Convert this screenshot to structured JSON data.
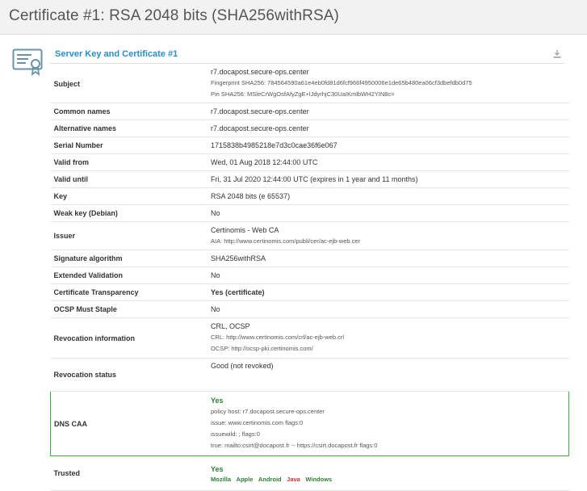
{
  "page": {
    "title": "Certificate #1: RSA 2048 bits (SHA256withRSA)"
  },
  "section": {
    "title": "Server Key and Certificate #1",
    "icon": "certificate-icon",
    "download_icon": "download-icon"
  },
  "colors": {
    "accent": "#2a8ec7",
    "green": "#2e7d32",
    "red": "#d32f2f",
    "dns_border": "#3fae49"
  },
  "rows": {
    "subject": {
      "label": "Subject",
      "value": "r7.docapost.secure-ops.center",
      "fingerprint": "Fingerprint SHA256: 784564590a61e4eb0fd81d6fcf966f4950006e1de65b480ea06cf3dbefdb0d75",
      "pin": "Pin SHA256: MSleCrWgOsfAfyZgE+lJdyrhjC30UaIKmlbWH2YIN8c="
    },
    "common_names": {
      "label": "Common names",
      "value": "r7.docapost.secure-ops.center"
    },
    "alt_names": {
      "label": "Alternative names",
      "value": "r7.docapost.secure-ops.center"
    },
    "serial": {
      "label": "Serial Number",
      "value": "1715838b4985218e7d3c0cae36f6e067"
    },
    "valid_from": {
      "label": "Valid from",
      "value": "Wed, 01 Aug 2018 12:44:00 UTC"
    },
    "valid_until": {
      "label": "Valid until",
      "value": "Fri, 31 Jul 2020 12:44:00 UTC (expires in 1 year and 11 months)"
    },
    "key": {
      "label": "Key",
      "value": "RSA 2048 bits (e 65537)"
    },
    "weak_key": {
      "label": "Weak key (Debian)",
      "value": "No"
    },
    "issuer": {
      "label": "Issuer",
      "value": "Certinomis - Web CA",
      "aia": "AIA: http://www.certinomis.com/publi/cer/ac-ejb-web.cer"
    },
    "sig_alg": {
      "label": "Signature algorithm",
      "value": "SHA256withRSA"
    },
    "ev": {
      "label": "Extended Validation",
      "value": "No"
    },
    "ct": {
      "label": "Certificate Transparency",
      "value": "Yes (certificate)"
    },
    "ocsp_staple": {
      "label": "OCSP Must Staple",
      "value": "No"
    },
    "revocation_info": {
      "label": "Revocation information",
      "value": "CRL, OCSP",
      "crl": "CRL: http://www.certinomis.com/crl/ac-ejb-web.crl",
      "ocsp": "OCSP: http://ocsp-pki.certinomis.com/"
    },
    "revocation_status": {
      "label": "Revocation status",
      "value": "Good (not revoked)"
    },
    "dns_caa": {
      "label": "DNS CAA",
      "value": "Yes",
      "policy": "policy host: r7.docapost.secure-ops.center",
      "issue": "issue: www.certinomis.com flags:0",
      "issuewild": "issuewild: ; flags:0",
      "iodef": "true: mailto:csirt@docapost.fr -- https://csirt.docapost.fr flags:0"
    },
    "trusted": {
      "label": "Trusted",
      "value": "Yes",
      "stores": [
        "Mozilla",
        "Apple",
        "Android",
        "Java",
        "Windows"
      ]
    }
  }
}
